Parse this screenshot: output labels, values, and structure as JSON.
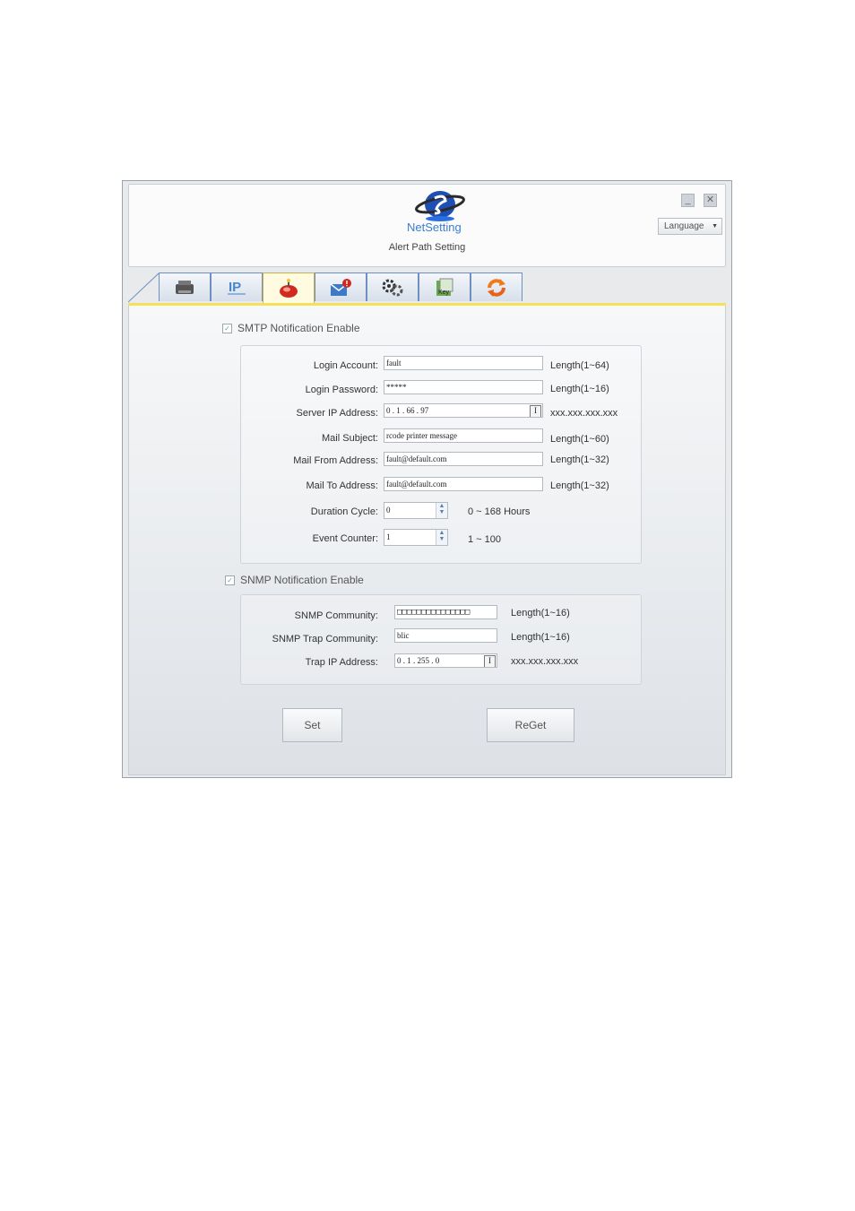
{
  "window": {
    "logo_text": "NetSetting",
    "title": "Alert Path Setting",
    "minimize_symbol": "_",
    "close_symbol": "✕",
    "language_label": "Language"
  },
  "tabs": [
    {
      "icon": "printer-icon"
    },
    {
      "icon": "ip-network-icon"
    },
    {
      "icon": "alert-icon",
      "active": true
    },
    {
      "icon": "mail-alert-icon"
    },
    {
      "icon": "settings-gears-icon"
    },
    {
      "icon": "key-icon"
    },
    {
      "icon": "refresh-icon"
    }
  ],
  "smtp": {
    "enable_label": "SMTP Notification Enable",
    "checked": true,
    "fields": {
      "login_account": {
        "label": "Login Account:",
        "value": "fault",
        "hint": "Length(1~64)"
      },
      "login_password": {
        "label": "Login Password:",
        "value": "*****",
        "hint": "Length(1~16)"
      },
      "server_ip": {
        "label": "Server IP Address:",
        "value": "0 . 1 . 66 . 97",
        "hint": "xxx.xxx.xxx.xxx"
      },
      "mail_subject": {
        "label": "Mail Subject:",
        "value": "rcode printer message",
        "hint": "Length(1~60)"
      },
      "mail_from": {
        "label": "Mail From Address:",
        "value": "fault@default.com",
        "hint": "Length(1~32)"
      },
      "mail_to": {
        "label": "Mail To Address:",
        "value": "fault@default.com",
        "hint": "Length(1~32)"
      },
      "duration_cycle": {
        "label": "Duration Cycle:",
        "value": "0",
        "hint": "0 ~ 168 Hours"
      },
      "event_counter": {
        "label": "Event Counter:",
        "value": "1",
        "hint": "1 ~ 100"
      }
    }
  },
  "snmp": {
    "enable_label": "SNMP Notification Enable",
    "checked": true,
    "fields": {
      "community": {
        "label": "SNMP Community:",
        "value": "□□□□□□□□□□□□□□□",
        "hint": "Length(1~16)"
      },
      "trap_community": {
        "label": "SNMP Trap Community:",
        "value": "blic",
        "hint": "Length(1~16)"
      },
      "trap_ip": {
        "label": "Trap IP Address:",
        "value": "0 . 1 . 255 . 0",
        "hint": "xxx.xxx.xxx.xxx"
      }
    }
  },
  "buttons": {
    "set": "Set",
    "reget": "ReGet"
  },
  "ip_button_symbol": "I",
  "spin_up": "▲",
  "spin_down": "▼",
  "colors": {
    "tab_border": "#6e8fc0",
    "active_tab": "#fffbe0",
    "accent_line": "#f4e157"
  }
}
